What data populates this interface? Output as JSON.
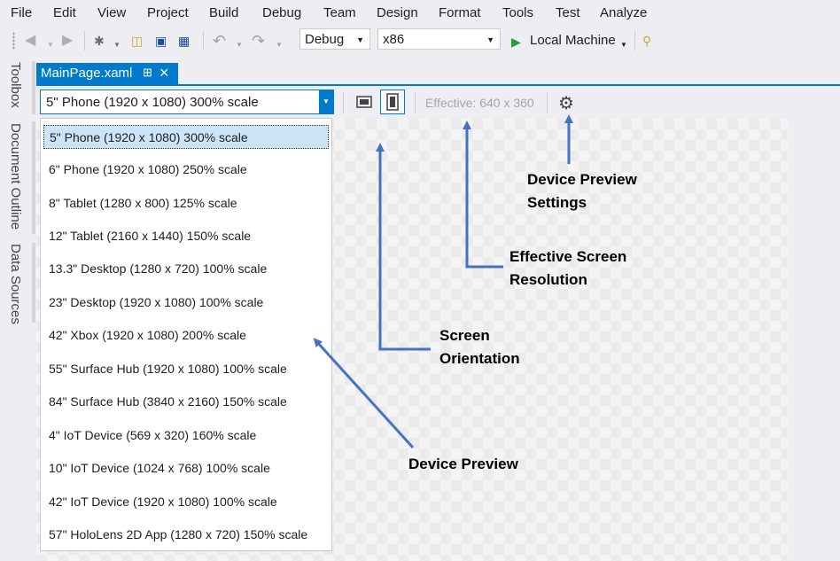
{
  "menu": [
    "File",
    "Edit",
    "View",
    "Project",
    "Build",
    "Debug",
    "Team",
    "Design",
    "Format",
    "Tools",
    "Test",
    "Analyze"
  ],
  "toolbar": {
    "configuration": "Debug",
    "platform": "x86",
    "run_target": "Local Machine"
  },
  "side_tabs": [
    "Toolbox",
    "Document Outline",
    "Data Sources"
  ],
  "doc_tab": {
    "title": "MainPage.xaml"
  },
  "designer": {
    "selected_device": "5\" Phone (1920 x 1080) 300% scale",
    "effective": "Effective: 640 x 360"
  },
  "devices": [
    "5\" Phone (1920 x 1080) 300% scale",
    "6\" Phone (1920 x 1080) 250% scale",
    "8\" Tablet (1280 x 800) 125% scale",
    "12\" Tablet (2160 x 1440) 150% scale",
    "13.3\" Desktop (1280 x 720) 100% scale",
    "23\" Desktop (1920 x 1080) 100% scale",
    "42\" Xbox (1920 x 1080) 200% scale",
    "55\" Surface Hub (1920 x 1080) 100% scale",
    "84\" Surface Hub (3840 x 2160) 150% scale",
    "4\" IoT Device (569 x 320) 160% scale",
    "10\" IoT Device (1024 x 768) 100% scale",
    "42\" IoT Device (1920 x 1080) 100% scale",
    "57\" HoloLens 2D App (1280 x 720) 150% scale"
  ],
  "annotations": {
    "settings": [
      "Device Preview",
      "Settings"
    ],
    "resolution": [
      "Effective Screen",
      "Resolution"
    ],
    "orientation": [
      "Screen",
      "Orientation"
    ],
    "preview": "Device Preview"
  },
  "colors": {
    "accent": "#007acc",
    "arrow": "#4472c4",
    "selection": "#cce4f7"
  }
}
